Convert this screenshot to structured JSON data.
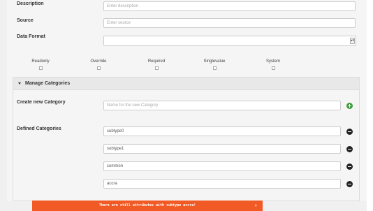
{
  "fields": {
    "description": {
      "label": "Description",
      "placeholder": "Enter description"
    },
    "source": {
      "label": "Source",
      "placeholder": "Enter source"
    },
    "data_format": {
      "label": "Data Format",
      "value": ""
    }
  },
  "flags": [
    {
      "label": "Readonly",
      "checked": false
    },
    {
      "label": "Override",
      "checked": false
    },
    {
      "label": "Required",
      "checked": false
    },
    {
      "label": "Singlevalue",
      "checked": false
    },
    {
      "label": "System",
      "checked": false
    }
  ],
  "categories": {
    "title": "Manage Categories",
    "create_label": "Create new Category",
    "create_placeholder": "Name for the new Category",
    "defined_label": "Defined Categories",
    "items": [
      "subtype0",
      "subtype1",
      "common",
      "accra"
    ]
  },
  "toast": {
    "message": "There are still attributes with subtype accra!",
    "close": "×"
  },
  "colors": {
    "toast_bg": "#f15a24",
    "add_button": "#3c9a3c",
    "remove_button": "#222222"
  },
  "icons": {
    "add": "plus-icon",
    "remove": "minus-icon",
    "collapse": "caret-down-icon",
    "select": "select-arrow-icon"
  }
}
